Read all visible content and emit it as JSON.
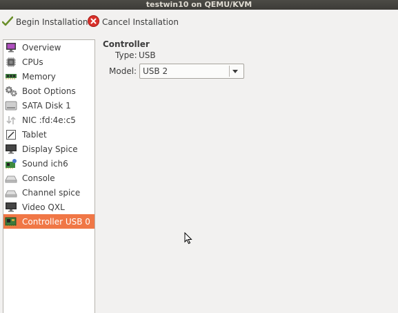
{
  "window": {
    "title": "testwin10 on QEMU/KVM"
  },
  "toolbar": {
    "begin_label": "Begin Installation",
    "cancel_label": "Cancel Installation"
  },
  "sidebar": {
    "items": [
      {
        "label": "Overview",
        "icon": "monitor-overview-icon"
      },
      {
        "label": "CPUs",
        "icon": "cpu-chip-icon"
      },
      {
        "label": "Memory",
        "icon": "memory-module-icon"
      },
      {
        "label": "Boot Options",
        "icon": "gears-icon"
      },
      {
        "label": "SATA Disk 1",
        "icon": "disk-icon"
      },
      {
        "label": "NIC :fd:4e:c5",
        "icon": "network-arrows-icon"
      },
      {
        "label": "Tablet",
        "icon": "tablet-icon"
      },
      {
        "label": "Display Spice",
        "icon": "display-icon"
      },
      {
        "label": "Sound ich6",
        "icon": "sound-card-icon"
      },
      {
        "label": "Console",
        "icon": "serial-port-icon"
      },
      {
        "label": "Channel spice",
        "icon": "serial-port-icon"
      },
      {
        "label": "Video QXL",
        "icon": "display-icon"
      },
      {
        "label": "Controller USB 0",
        "icon": "pci-card-icon",
        "selected": true
      }
    ]
  },
  "details": {
    "section_title": "Controller",
    "type_label": "Type:",
    "type_value": "USB",
    "model_label": "Model:",
    "model_value": "USB 2"
  },
  "colors": {
    "selection": "#f07746",
    "titlebar": "#3c3b37",
    "background": "#f2f1f0"
  }
}
